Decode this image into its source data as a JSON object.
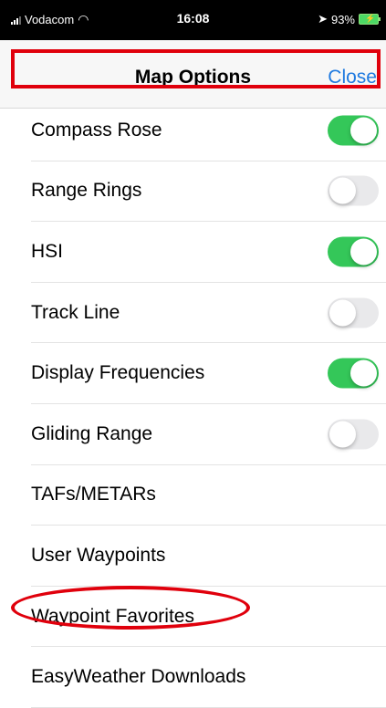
{
  "status_bar": {
    "carrier": "Vodacom",
    "time": "16:08",
    "battery": "93%"
  },
  "nav": {
    "title": "Map Options",
    "close_label": "Close"
  },
  "items": [
    {
      "label": "Compass Rose",
      "toggle": true
    },
    {
      "label": "Range Rings",
      "toggle": false
    },
    {
      "label": "HSI",
      "toggle": true
    },
    {
      "label": "Track Line",
      "toggle": false
    },
    {
      "label": "Display Frequencies",
      "toggle": true
    },
    {
      "label": "Gliding Range",
      "toggle": false
    },
    {
      "label": "TAFs/METARs"
    },
    {
      "label": "User Waypoints"
    },
    {
      "label": "Waypoint Favorites"
    },
    {
      "label": "EasyWeather Downloads"
    }
  ],
  "colors": {
    "toggle_on": "#34c759",
    "toggle_off": "#e9e9eb",
    "link": "#1f7ae0",
    "annotation": "#e0000c"
  }
}
